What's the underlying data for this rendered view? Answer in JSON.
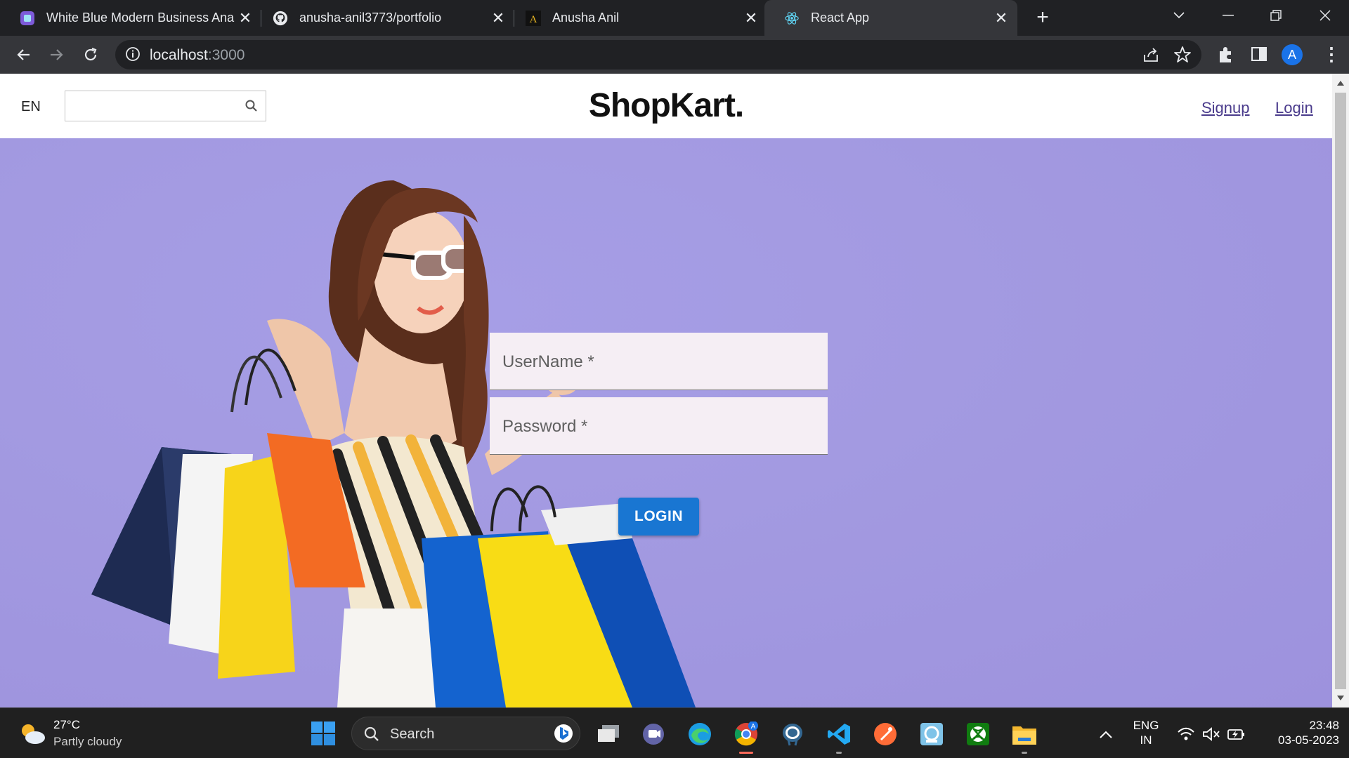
{
  "browser": {
    "tabs": [
      {
        "title": "White Blue Modern Business Ana",
        "favicon": "canva-icon"
      },
      {
        "title": "anusha-anil3773/portfolio",
        "favicon": "github-icon"
      },
      {
        "title": "Anusha Anil",
        "favicon": "a-logo-icon"
      },
      {
        "title": "React App",
        "favicon": "react-icon",
        "active": true
      }
    ],
    "close_glyph": "✕",
    "new_tab": "+",
    "url_host": "localhost",
    "url_port": ":3000",
    "profile_initial": "A"
  },
  "site": {
    "lang": "EN",
    "search_placeholder": "",
    "logo": "ShopKart.",
    "signup": "Signup",
    "login_link": "Login"
  },
  "form": {
    "username_label": "UserName *",
    "password_label": "Password *",
    "submit": "LOGIN",
    "accent": "#1976d2",
    "hero_bg": "#a39ae1"
  },
  "taskbar": {
    "weather_temp": "27°C",
    "weather_cond": "Partly cloudy",
    "search": "Search",
    "lang_top": "ENG",
    "lang_bottom": "IN",
    "time": "23:48",
    "date": "03-05-2023"
  }
}
